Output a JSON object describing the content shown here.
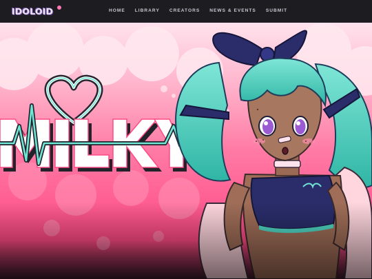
{
  "logo": {
    "text": "IDOLOID"
  },
  "nav": {
    "items": [
      {
        "label": "HOME"
      },
      {
        "label": "LIBRARY"
      },
      {
        "label": "CREATORS"
      },
      {
        "label": "NEWS & EVENTS"
      },
      {
        "label": "SUBMIT"
      }
    ]
  },
  "hero": {
    "title_logo_text": "MILKY",
    "character": "milky-character-illustration"
  },
  "colors": {
    "topbar": "#1c1c21",
    "hero_pink_light": "#ffd9e6",
    "hero_pink": "#ff7fa8",
    "hero_pink_deep": "#ff3f7c",
    "teal_hair": "#4fd6c4",
    "navy": "#2a2d6a"
  }
}
